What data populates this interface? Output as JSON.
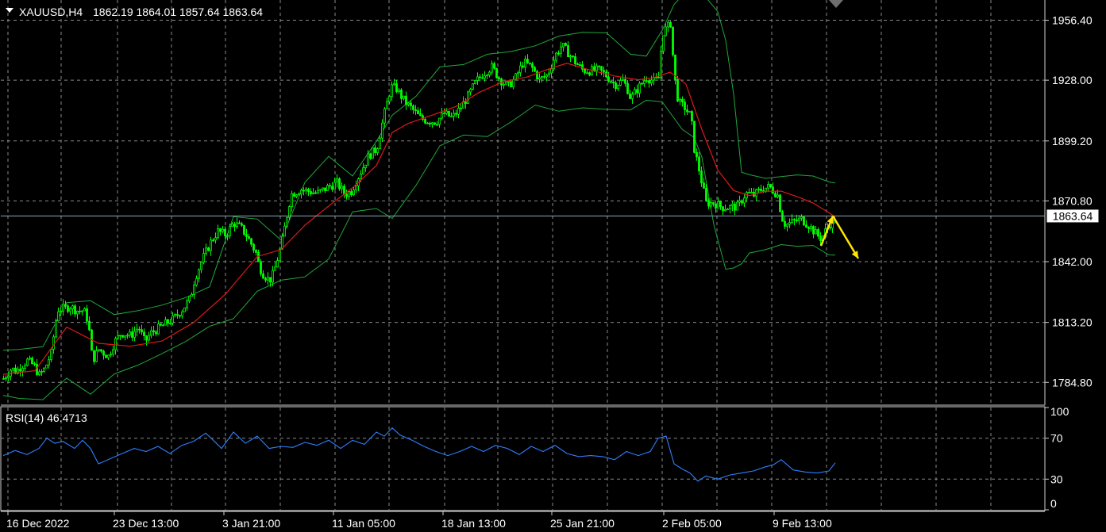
{
  "header": {
    "symbol": "XAUUSD,H4",
    "ohlc": "1862.19 1864.01 1857.64 1863.64"
  },
  "rsi_label": "RSI(14) 46.4713",
  "colors": {
    "background": "#000000",
    "grid": "#8a8a8a",
    "candle": "#00ff00",
    "bands": "#1fa83a",
    "ma": "#e01818",
    "rsi": "#2f7fff",
    "bid_line": "#8aa6b8",
    "arrow": "#ffe600",
    "text": "#ffffff"
  },
  "chart_data": [
    {
      "type": "candlestick",
      "title": "XAUUSD,H4",
      "last_price": "1863.64",
      "ylim": [
        1774.0,
        1966.0
      ],
      "y_ticks": [
        "1956.40",
        "1928.00",
        "1899.20",
        "1870.80",
        "1842.00",
        "1813.20",
        "1784.80"
      ],
      "x_ticks": [
        "16 Dec 2022",
        "23 Dec 13:00",
        "3 Jan 21:00",
        "11 Jan 05:00",
        "18 Jan 13:00",
        "25 Jan 21:00",
        "2 Feb 05:00",
        "9 Feb 13:00"
      ],
      "overlays": [
        "Bollinger Bands (upper / middle / lower)",
        "moving average"
      ],
      "series": [
        {
          "name": "close",
          "x": [
            0,
            10,
            16,
            20,
            30,
            38,
            45,
            52,
            60,
            68,
            78,
            84,
            92,
            100,
            104,
            108,
            112,
            120,
            132,
            140,
            148,
            160,
            170,
            178,
            185,
            195,
            205,
            215,
            225,
            235,
            241,
            250,
            262,
            270,
            280,
            290,
            300,
            306,
            312,
            318,
            322,
            327,
            335,
            340,
            350,
            362,
            375,
            395,
            410,
            420,
            430,
            438,
            450,
            460,
            470,
            480,
            488,
            495,
            505,
            515,
            525,
            535,
            545,
            555,
            565,
            575,
            585,
            595,
            605,
            615,
            625,
            635,
            645,
            655,
            665,
            675,
            685,
            695,
            703,
            710,
            720,
            730,
            740,
            750,
            760,
            770,
            780,
            785,
            790,
            800,
            810,
            820,
            825,
            830,
            835,
            840,
            845,
            850,
            858,
            866,
            870,
            876,
            885,
            895,
            905,
            915,
            925,
            935,
            945,
            955,
            965,
            975,
            980,
            985,
            995,
            1005,
            1015,
            1025,
            1030,
            1035,
            1040,
            1045,
            1048
          ],
          "values": [
            1786.6,
            1791.4,
            1789.9,
            1791.7,
            1795.1,
            1792.9,
            1788.2,
            1791.4,
            1798.6,
            1819.3,
            1820.0,
            1820.8,
            1818.8,
            1818.8,
            1817.3,
            1809.0,
            1795.1,
            1800.4,
            1797.2,
            1804.1,
            1808.2,
            1806.9,
            1811.0,
            1803.9,
            1808.0,
            1810.4,
            1812.8,
            1815.2,
            1819.3,
            1824.4,
            1834.1,
            1842.7,
            1852.1,
            1856.4,
            1854.7,
            1860.5,
            1857.6,
            1854.5,
            1850.4,
            1846.1,
            1839.8,
            1836.2,
            1833.0,
            1836.4,
            1850.2,
            1873.9,
            1876.2,
            1874.4,
            1877.6,
            1879.3,
            1873.9,
            1875.4,
            1884.6,
            1892.4,
            1895.4,
            1912.6,
            1924.9,
            1923.9,
            1918.0,
            1914.2,
            1910.0,
            1908.6,
            1908.4,
            1912.2,
            1910.2,
            1914.6,
            1920.4,
            1927.3,
            1931.4,
            1934.2,
            1928.5,
            1924.9,
            1929.3,
            1936.6,
            1934.3,
            1928.3,
            1930.4,
            1939.7,
            1944.5,
            1941.6,
            1936.6,
            1932.6,
            1932.5,
            1932.8,
            1929.9,
            1925.9,
            1927.8,
            1924.7,
            1919.2,
            1924.7,
            1929.3,
            1927.3,
            1929.3,
            1950.5,
            1952.5,
            1955.0,
            1929.9,
            1917.5,
            1915.0,
            1910.6,
            1895.4,
            1885.6,
            1869.8,
            1869.8,
            1867.8,
            1867.8,
            1868.2,
            1874.4,
            1873.5,
            1876.5,
            1877.4,
            1873.5,
            1863.2,
            1859.3,
            1861.0,
            1862.1,
            1858.9,
            1854.5,
            1852.9,
            1856.4,
            1859.7,
            1860.9,
            1863.6
          ]
        },
        {
          "name": "moving average",
          "x": [
            0,
            40,
            80,
            120,
            160,
            200,
            240,
            280,
            320,
            350,
            380,
            410,
            440,
            470,
            490,
            510,
            540,
            570,
            600,
            630,
            660,
            690,
            710,
            740,
            770,
            800,
            820,
            840,
            860,
            880,
            900,
            920,
            940,
            960,
            980,
            1000,
            1020,
            1040,
            1048
          ],
          "values": [
            1788.6,
            1790.3,
            1811.0,
            1803.3,
            1801.9,
            1804.4,
            1813.2,
            1826.6,
            1844.4,
            1847.7,
            1859.3,
            1868.4,
            1877.0,
            1887.5,
            1903.2,
            1907.5,
            1911.4,
            1915.5,
            1922.3,
            1927.3,
            1929.5,
            1933.7,
            1936.0,
            1932.7,
            1930.0,
            1928.2,
            1929.3,
            1931.8,
            1926.1,
            1904.6,
            1885.4,
            1875.7,
            1873.3,
            1875.4,
            1875.4,
            1872.8,
            1869.8,
            1865.2,
            1863.2
          ]
        },
        {
          "name": "upper band",
          "x": [
            0,
            20,
            50,
            80,
            110,
            140,
            170,
            200,
            230,
            260,
            290,
            320,
            350,
            380,
            410,
            440,
            470,
            490,
            520,
            550,
            580,
            610,
            640,
            670,
            700,
            730,
            760,
            790,
            810,
            830,
            845,
            855,
            870,
            880,
            900,
            910,
            920,
            930,
            940,
            960,
            980,
            1000,
            1020,
            1040,
            1048
          ],
          "values": [
            1800.0,
            1800.4,
            1801.7,
            1822.6,
            1823.5,
            1816.9,
            1818.8,
            1821.4,
            1825.0,
            1830.1,
            1863.3,
            1862.2,
            1852.2,
            1879.6,
            1891.9,
            1882.6,
            1899.0,
            1911.4,
            1920.4,
            1934.3,
            1935.4,
            1940.3,
            1941.6,
            1944.3,
            1948.9,
            1950.7,
            1950.4,
            1940.3,
            1939.4,
            1951.6,
            1963.9,
            1968.0,
            1969.1,
            1969.5,
            1960.5,
            1946.9,
            1921.4,
            1884.4,
            1883.2,
            1881.5,
            1882.3,
            1883.1,
            1882.6,
            1879.8,
            1879.3
          ]
        },
        {
          "name": "lower band",
          "x": [
            0,
            20,
            50,
            80,
            110,
            140,
            170,
            200,
            230,
            260,
            290,
            320,
            350,
            380,
            410,
            440,
            470,
            490,
            520,
            550,
            580,
            610,
            640,
            670,
            700,
            730,
            760,
            790,
            810,
            830,
            845,
            855,
            870,
            880,
            895,
            910,
            920,
            930,
            940,
            960,
            980,
            1000,
            1020,
            1040,
            1048
          ],
          "values": [
            1778.6,
            1777.2,
            1776.6,
            1786.8,
            1779.2,
            1788.8,
            1793.0,
            1798.4,
            1804.2,
            1811.4,
            1815.0,
            1828.0,
            1833.2,
            1834.8,
            1843.3,
            1865.6,
            1867.2,
            1862.5,
            1878.2,
            1896.9,
            1902.0,
            1901.3,
            1908.3,
            1916.2,
            1913.3,
            1914.9,
            1914.2,
            1913.9,
            1918.5,
            1917.7,
            1910.0,
            1904.8,
            1900.9,
            1891.6,
            1859.6,
            1838.4,
            1839.0,
            1841.0,
            1846.1,
            1847.7,
            1850.1,
            1849.3,
            1849.7,
            1845.2,
            1845.1
          ]
        }
      ]
    },
    {
      "type": "line",
      "title": "RSI(14) 46.4713",
      "ylim": [
        0,
        100
      ],
      "y_ticks": [
        "100",
        "70",
        "30",
        "0"
      ],
      "series": [
        {
          "name": "RSI(14)",
          "x": [
            0,
            15,
            30,
            45,
            55,
            65,
            75,
            90,
            100,
            110,
            120,
            135,
            150,
            165,
            180,
            195,
            210,
            225,
            240,
            255,
            262,
            275,
            290,
            305,
            320,
            335,
            350,
            365,
            380,
            395,
            410,
            425,
            440,
            455,
            470,
            480,
            490,
            500,
            515,
            530,
            545,
            560,
            575,
            590,
            605,
            620,
            635,
            650,
            665,
            680,
            695,
            710,
            725,
            740,
            755,
            770,
            785,
            800,
            815,
            825,
            835,
            845,
            855,
            865,
            875,
            885,
            900,
            915,
            930,
            945,
            960,
            970,
            980,
            995,
            1010,
            1025,
            1040,
            1048
          ],
          "values": [
            53,
            58,
            54,
            60,
            70,
            65,
            67,
            60,
            68,
            60,
            45,
            50,
            55,
            60,
            57,
            62,
            55,
            63,
            67,
            75,
            70,
            60,
            76,
            65,
            72,
            60,
            62,
            61,
            66,
            63,
            68,
            60,
            68,
            64,
            76,
            72,
            80,
            73,
            68,
            62,
            57,
            53,
            57,
            62,
            57,
            63,
            60,
            54,
            62,
            57,
            63,
            55,
            52,
            53,
            52,
            49,
            57,
            53,
            57,
            70,
            72,
            45,
            40,
            36,
            28,
            33,
            30,
            34,
            36,
            38,
            42,
            44,
            49,
            39,
            37,
            36,
            38,
            46
          ]
        }
      ]
    }
  ]
}
